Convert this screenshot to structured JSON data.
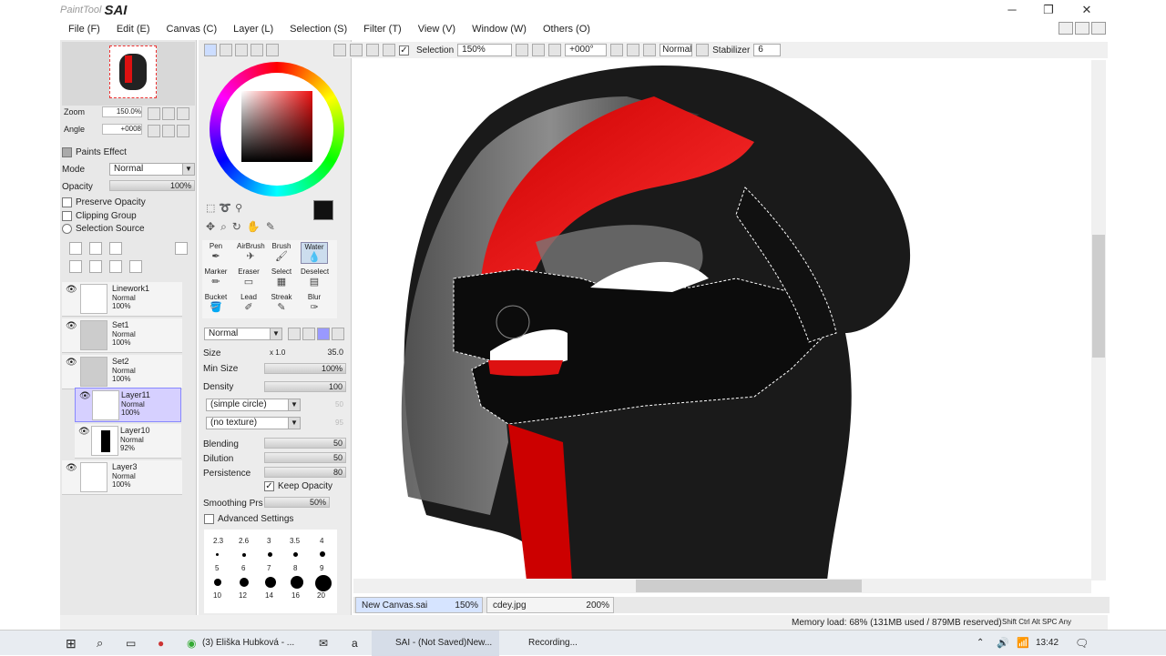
{
  "app": {
    "logo_small": "PaintTool",
    "logo_big": "SAI"
  },
  "window": {
    "minimize": "─",
    "restore": "❐",
    "close": "✕"
  },
  "menu": [
    "File (F)",
    "Edit (E)",
    "Canvas (C)",
    "Layer (L)",
    "Selection (S)",
    "Filter (T)",
    "View (V)",
    "Window (W)",
    "Others (O)"
  ],
  "navigator": {
    "zoom_label": "Zoom",
    "zoom_value": "150.0%",
    "angle_label": "Angle",
    "angle_value": "+0008"
  },
  "paints_effect": "Paints Effect",
  "layer_props": {
    "mode_label": "Mode",
    "mode_value": "Normal",
    "opacity_label": "Opacity",
    "opacity_value": "100%",
    "preserve_opacity": "Preserve Opacity",
    "clipping_group": "Clipping Group",
    "selection_source": "Selection Source"
  },
  "layers": [
    {
      "name": "Linework1",
      "mode": "Normal",
      "opacity": "100%"
    },
    {
      "name": "Set1",
      "mode": "Normal",
      "opacity": "100%"
    },
    {
      "name": "Set2",
      "mode": "Normal",
      "opacity": "100%"
    },
    {
      "name": "Layer11",
      "mode": "Normal",
      "opacity": "100%"
    },
    {
      "name": "Layer10",
      "mode": "Normal",
      "opacity": "92%"
    },
    {
      "name": "Layer3",
      "mode": "Normal",
      "opacity": "100%"
    }
  ],
  "tools": {
    "row1": [
      "Pen",
      "AirBrush",
      "Brush",
      "Water"
    ],
    "row2": [
      "Marker",
      "Eraser",
      "Select",
      "Deselect"
    ],
    "row3": [
      "Bucket",
      "Lead",
      "Streak",
      "Blur"
    ]
  },
  "brush": {
    "blend_mode": "Normal",
    "size_label": "Size",
    "size_mult": "x 1.0",
    "size_value": "35.0",
    "min_size_label": "Min Size",
    "min_size_value": "100%",
    "density_label": "Density",
    "density_value": "100",
    "shape": "(simple circle)",
    "shape_val": "50",
    "texture": "(no texture)",
    "texture_val": "95",
    "blending_label": "Blending",
    "blending_value": "50",
    "dilution_label": "Dilution",
    "dilution_value": "50",
    "persistence_label": "Persistence",
    "persistence_value": "80",
    "keep_opacity": "Keep Opacity",
    "smoothing_label": "Smoothing Prs",
    "smoothing_value": "50%",
    "advanced": "Advanced Settings"
  },
  "brush_sizes": [
    [
      "2.3",
      "2.6",
      "3",
      "3.5",
      "4"
    ],
    [
      "5",
      "6",
      "7",
      "8",
      "9"
    ],
    [
      "10",
      "12",
      "14",
      "16",
      "20"
    ]
  ],
  "toolbar": {
    "selection_label": "Selection",
    "zoom": "150%",
    "angle": "+000°",
    "mode": "Normal",
    "stabilizer_label": "Stabilizer",
    "stabilizer_value": "6"
  },
  "tabs": [
    {
      "name": "New Canvas.sai",
      "zoom": "150%"
    },
    {
      "name": "cdey.jpg",
      "zoom": "200%"
    }
  ],
  "status": {
    "memory": "Memory load: 68% (131MB used / 879MB reserved)",
    "keys": "Shift Ctrl Alt SPC Any"
  },
  "taskbar": {
    "chrome": "(3) Eliška Hubková - ...",
    "sai": "SAI - (Not Saved)New...",
    "rec": "Recording...",
    "time": "13:42"
  }
}
